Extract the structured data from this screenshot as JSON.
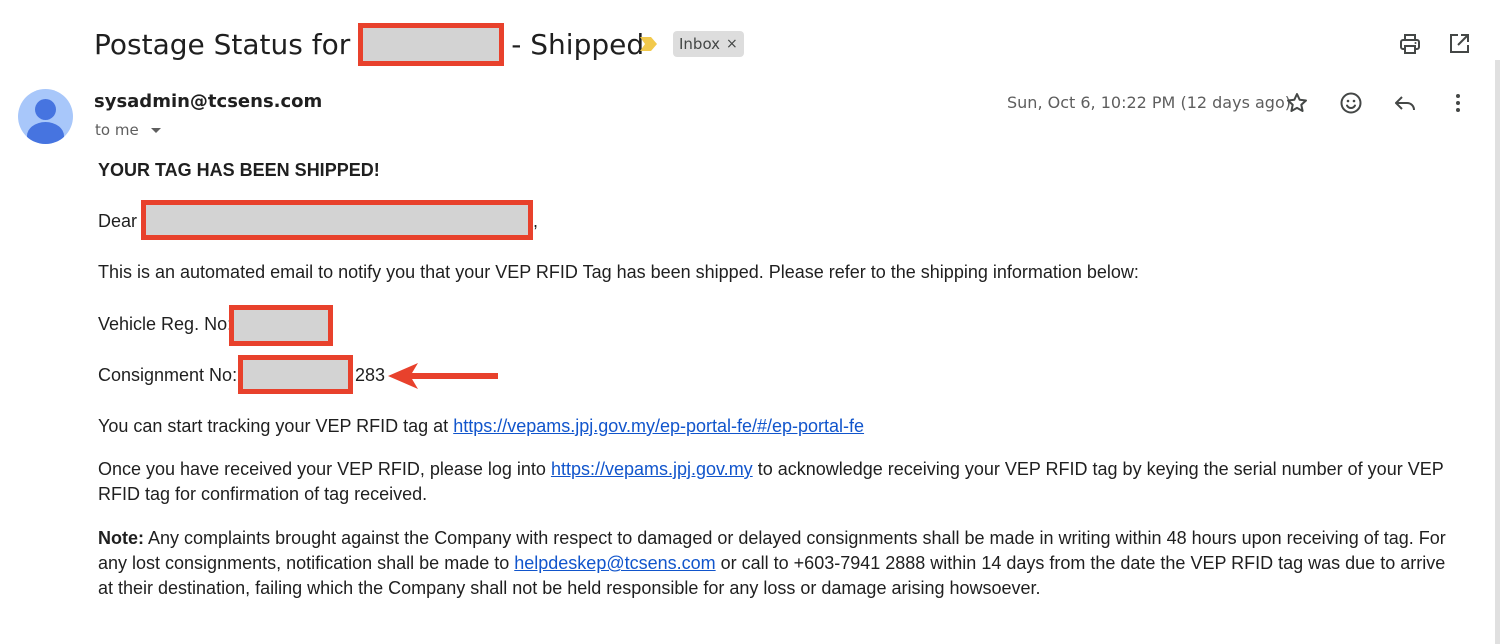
{
  "header": {
    "subject_prefix": "Postage Status for",
    "subject_suffix": "- Shipped",
    "label": "Inbox",
    "label_close": "×"
  },
  "sender": {
    "email": "sysadmin@tcsens.com",
    "recipient": "to me",
    "date": "Sun, Oct 6, 10:22 PM (12 days ago)"
  },
  "body": {
    "heading": "YOUR TAG HAS BEEN SHIPPED!",
    "greeting": "Dear",
    "greeting_comma": ",",
    "intro": "This is an automated email to notify you that your VEP RFID Tag has been shipped. Please refer to the shipping information below:",
    "vehicle_label": "Vehicle Reg. No:",
    "consignment_label": "Consignment No:",
    "consignment_suffix": "283",
    "tracking_text": "You can start tracking your VEP RFID tag at",
    "tracking_link": "https://vepams.jpj.gov.my/ep-portal-fe/#/ep-portal-fe",
    "received_text_1": "Once you have received your VEP RFID, please log into",
    "received_link": "https://vepams.jpj.gov.my",
    "received_text_2": "to acknowledge receiving your VEP RFID tag by keying the serial number of your VEP RFID tag for confirmation of tag received.",
    "note_label": "Note:",
    "note_text_1": "Any complaints brought against the Company with respect to damaged or delayed consignments shall be made in writing within 48 hours upon receiving of tag. For any lost consignments, notification shall be made to",
    "note_email": "helpdeskep@tcsens.com",
    "note_text_2": "or call to +603-7941 2888 within 14 days from the date the VEP RFID tag was due to arrive at their destination, failing which the Company shall not be held responsible for any loss or damage arising howsoever."
  },
  "icons": {
    "print": "print-icon",
    "open_new_window": "open-in-new-window-icon",
    "star": "star-icon",
    "emoji": "emoji-icon",
    "reply": "reply-icon",
    "more": "more-vertical-icon",
    "important": "important-marker-icon"
  },
  "colors": {
    "redaction_border": "#e8412c",
    "redaction_fill": "#d3d3d3",
    "link": "#1155cc",
    "avatar_bg": "#a8c7fa",
    "avatar_fg": "#4674e0",
    "important_marker": "#f2c94c"
  }
}
